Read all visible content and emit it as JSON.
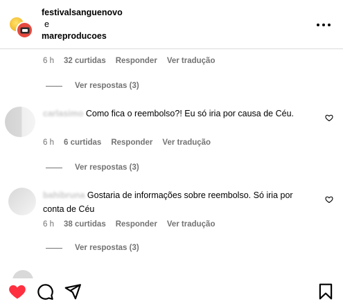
{
  "header": {
    "user1": "festivalsanguenovo",
    "and": "e",
    "user2": "mareproducoes"
  },
  "comment0": {
    "time": "6 h",
    "likes": "32 curtidas",
    "reply": "Responder",
    "translate": "Ver tradução",
    "view_replies": "Ver respostas (3)"
  },
  "comment1": {
    "username": "carlasimo",
    "text": "Como fica o reembolso?! Eu só iria por causa de Céu.",
    "time": "6 h",
    "likes": "6 curtidas",
    "reply": "Responder",
    "translate": "Ver tradução",
    "view_replies": "Ver respostas (3)"
  },
  "comment2": {
    "username": "bahibruna",
    "text": "Gostaria de informações sobre reembolso. Só iria por conta de Céu",
    "time": "6 h",
    "likes": "38 curtidas",
    "reply": "Responder",
    "translate": "Ver tradução",
    "view_replies": "Ver respostas (3)"
  },
  "icons": {
    "more": "more-horizontal-icon",
    "like_small": "heart-outline-icon",
    "like": "heart-filled-icon",
    "comment": "comment-icon",
    "share": "send-icon",
    "save": "bookmark-icon"
  },
  "colors": {
    "like_red": "#ff3040",
    "meta_gray": "#737373",
    "avatar_red": "#e5493f",
    "avatar_yellow": "#f5c23a"
  }
}
